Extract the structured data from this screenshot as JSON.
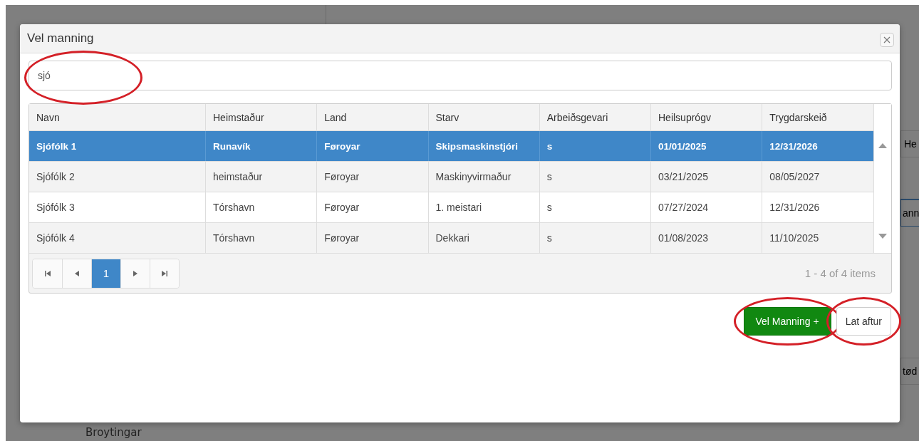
{
  "background_page": {
    "heading": "Broytingar",
    "fragments": [
      "He",
      "ann",
      "tød"
    ]
  },
  "dialog": {
    "title": "Vel manning",
    "search": {
      "value": "sjó",
      "circled": true
    },
    "table": {
      "columns": [
        "Navn",
        "Heimstaður",
        "Land",
        "Starv",
        "Arbeiðsgevari",
        "Heilsuprógv",
        "Trygdarskeið"
      ],
      "rows": [
        {
          "selected": true,
          "cells": [
            "Sjófólk 1",
            "Runavík",
            "Føroyar",
            "Skipsmaskinstjóri",
            "s",
            "01/01/2025",
            "12/31/2026"
          ]
        },
        {
          "selected": false,
          "cells": [
            "Sjófólk 2",
            "heimstaður",
            "Føroyar",
            "Maskinyvirmaður",
            "s",
            "03/21/2025",
            "08/05/2027"
          ]
        },
        {
          "selected": false,
          "cells": [
            "Sjófólk 3",
            "Tórshavn",
            "Føroyar",
            "1. meistari",
            "s",
            "07/27/2024",
            "12/31/2026"
          ]
        },
        {
          "selected": false,
          "cells": [
            "Sjófólk 4",
            "Tórshavn",
            "Føroyar",
            "Dekkari",
            "s",
            "01/08/2023",
            "11/10/2025"
          ]
        }
      ]
    },
    "pager": {
      "pages": [
        {
          "label": "1",
          "selected": true
        }
      ],
      "summary": "1 - 4 of 4 items"
    },
    "buttons": [
      {
        "label": "Vel Manning +",
        "kind": "primary",
        "circled": true
      },
      {
        "label": "Lat aftur",
        "kind": "default",
        "circled": true
      }
    ]
  }
}
